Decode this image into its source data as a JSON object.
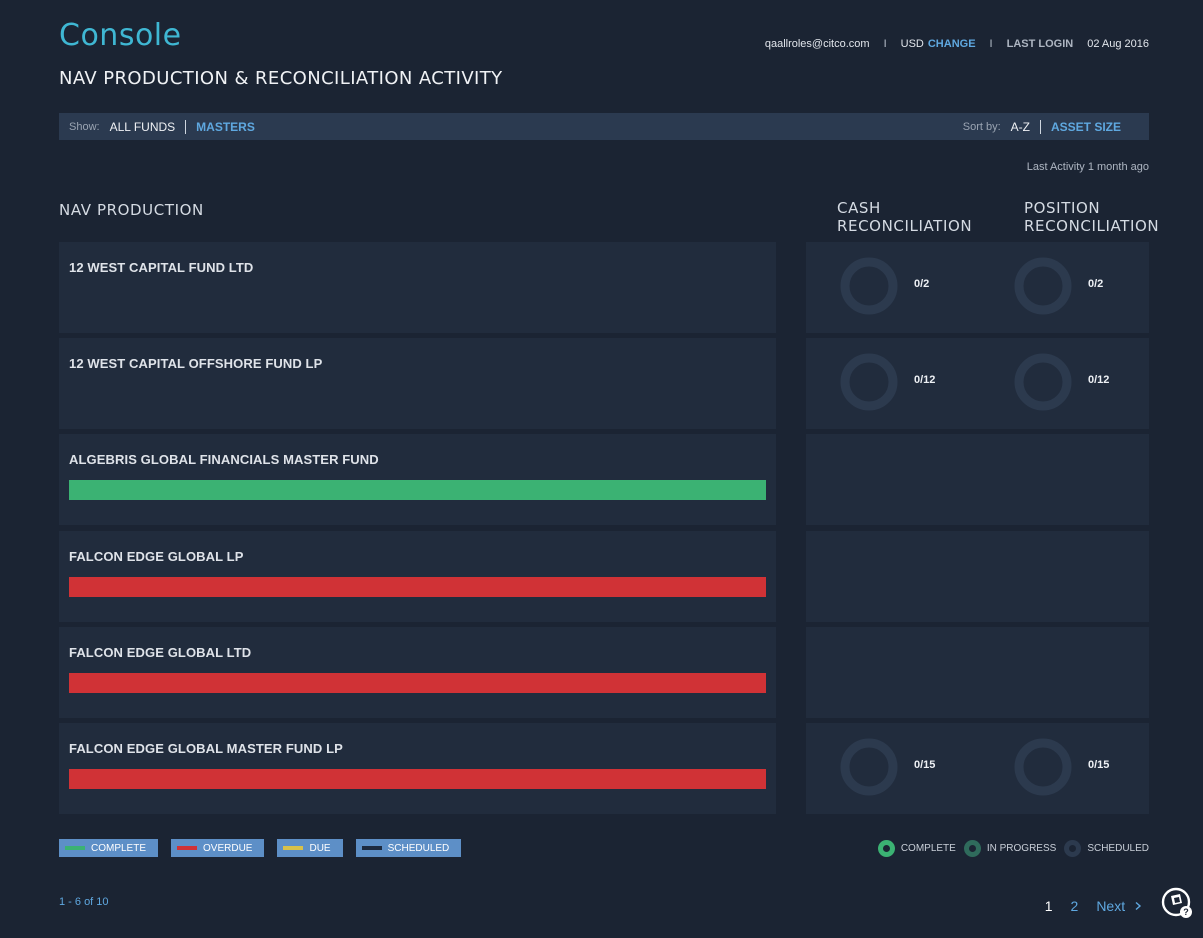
{
  "app": {
    "title": "Console"
  },
  "user_bar": {
    "email": "qaallroles@citco.com",
    "separator": "I",
    "currency": "USD",
    "change_label": "CHANGE",
    "last_login_label": "LAST LOGIN",
    "last_login_date": "02 Aug 2016"
  },
  "page": {
    "title": "NAV PRODUCTION & RECONCILIATION ACTIVITY"
  },
  "filter": {
    "show_label": "Show:",
    "options": [
      "ALL FUNDS",
      "MASTERS"
    ],
    "sort_label": "Sort by:",
    "sort_options": [
      "A-Z",
      "ASSET SIZE"
    ]
  },
  "last_activity": "Last Activity 1 month ago",
  "sections": {
    "nav": "NAV PRODUCTION",
    "cash": [
      "CASH",
      "RECONCILIATION"
    ],
    "position": [
      "POSITION",
      "RECONCILIATION"
    ]
  },
  "colors": {
    "complete": "#3bb273",
    "overdue": "#d03236",
    "due": "#d8c14a",
    "scheduled": "#1d2a3f",
    "donut_track": "#2c3a4e",
    "accent": "#5fa8e0"
  },
  "funds": [
    {
      "name": "12 WEST CAPITAL FUND LTD",
      "status": "none",
      "cash": "0/2",
      "position": "0/2"
    },
    {
      "name": "12 WEST CAPITAL OFFSHORE FUND LP",
      "status": "none",
      "cash": "0/12",
      "position": "0/12"
    },
    {
      "name": "ALGEBRIS GLOBAL FINANCIALS MASTER FUND",
      "status": "complete",
      "cash": "",
      "position": ""
    },
    {
      "name": "FALCON EDGE GLOBAL LP",
      "status": "overdue",
      "cash": "",
      "position": ""
    },
    {
      "name": "FALCON EDGE GLOBAL LTD",
      "status": "overdue",
      "cash": "",
      "position": ""
    },
    {
      "name": "FALCON EDGE GLOBAL MASTER FUND LP",
      "status": "overdue",
      "cash": "0/15",
      "position": "0/15"
    }
  ],
  "legend": {
    "bars": [
      {
        "label": "COMPLETE",
        "key": "complete"
      },
      {
        "label": "OVERDUE",
        "key": "overdue"
      },
      {
        "label": "DUE",
        "key": "due"
      },
      {
        "label": "SCHEDULED",
        "key": "scheduled"
      }
    ],
    "donuts": [
      {
        "label": "COMPLETE",
        "color": "#3bb273"
      },
      {
        "label": "IN PROGRESS",
        "color": "#2f6b5c"
      },
      {
        "label": "SCHEDULED",
        "color": "#2c3a4e"
      }
    ]
  },
  "pagination": {
    "info": "1 - 6 of 10",
    "pages": [
      "1",
      "2"
    ],
    "current": "1",
    "next_label": "Next"
  },
  "icons": {
    "help": "help-icon",
    "next": "chevron-right-icon"
  }
}
